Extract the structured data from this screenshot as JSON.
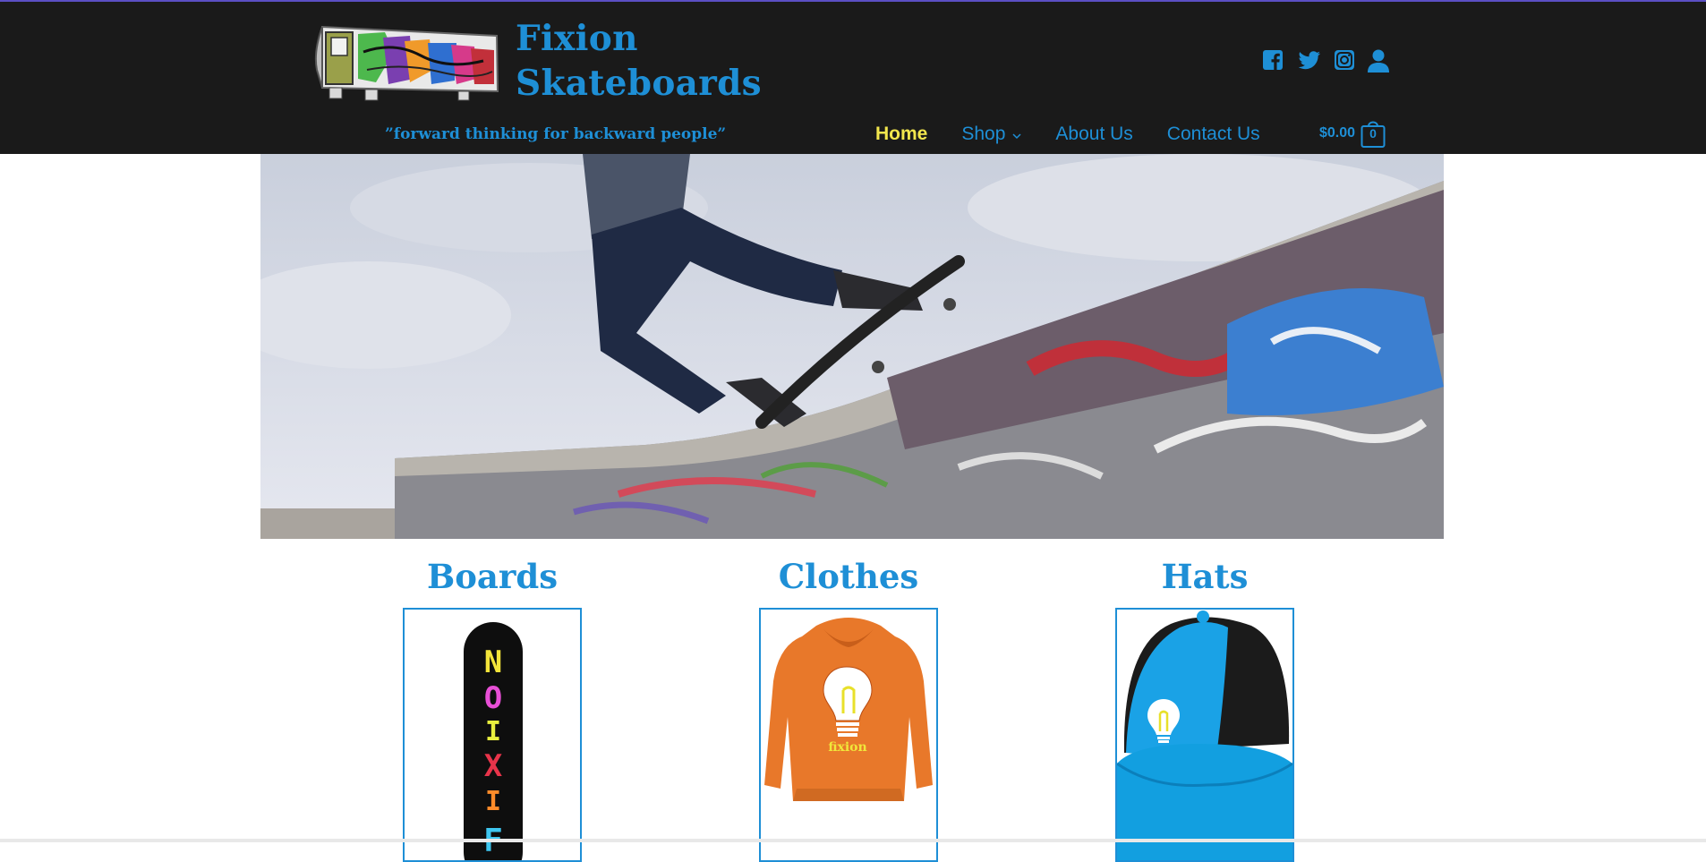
{
  "site": {
    "title_line1": "Fixion",
    "title_line2": "Skateboards",
    "tagline": "”forward thinking for backward people”",
    "colors": {
      "brand_blue": "#1e8fd6",
      "header_bg": "#1a1a1a",
      "active_nav": "#f2e64d"
    }
  },
  "social": {
    "icons": [
      "facebook-icon",
      "twitter-icon",
      "instagram-icon",
      "account-icon"
    ]
  },
  "nav": {
    "items": [
      {
        "label": "Home",
        "active": true
      },
      {
        "label": "Shop",
        "has_dropdown": true
      },
      {
        "label": "About Us"
      },
      {
        "label": "Contact Us"
      }
    ]
  },
  "cart": {
    "total": "$0.00",
    "count": "0"
  },
  "categories": [
    {
      "title": "Boards"
    },
    {
      "title": "Clothes"
    },
    {
      "title": "Hats"
    }
  ],
  "product_art": {
    "board_text": "FIXION",
    "hoodie_text": "fixion"
  }
}
